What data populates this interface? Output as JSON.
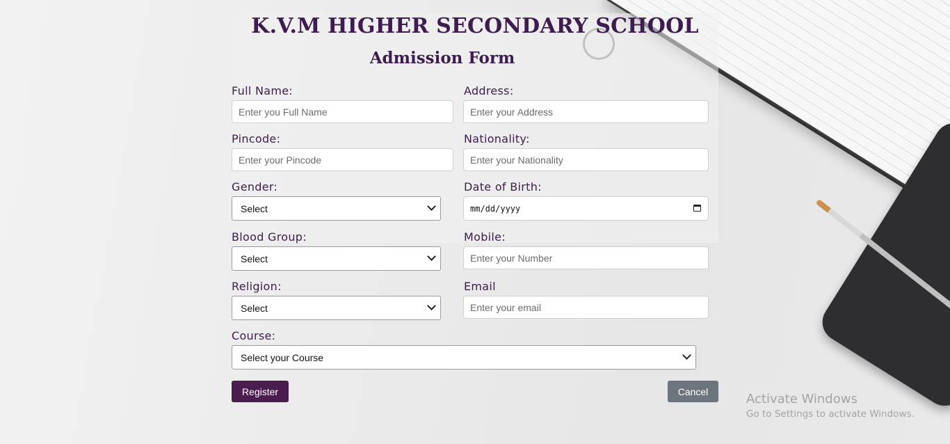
{
  "header": {
    "school_name": "K.V.M HIGHER SECONDARY SCHOOL",
    "form_title": "Admission Form"
  },
  "fields": {
    "full_name": {
      "label": "Full Name:",
      "placeholder": "Enter you Full Name"
    },
    "address": {
      "label": "Address:",
      "placeholder": "Enter your Address"
    },
    "pincode": {
      "label": "Pincode:",
      "placeholder": "Enter your Pincode"
    },
    "nationality": {
      "label": "Nationality:",
      "placeholder": "Enter your Nationality"
    },
    "gender": {
      "label": "Gender:",
      "selected": "Select"
    },
    "dob": {
      "label": "Date of Birth:",
      "value": "mm/dd/yyyy"
    },
    "blood_group": {
      "label": "Blood Group:",
      "selected": "Select"
    },
    "mobile": {
      "label": "Mobile:",
      "placeholder": "Enter your Number"
    },
    "religion": {
      "label": "Religion:",
      "selected": "Select"
    },
    "email": {
      "label": "Email",
      "placeholder": "Enter your email"
    },
    "course": {
      "label": "Course:",
      "selected": "Select your Course"
    }
  },
  "buttons": {
    "register": "Register",
    "cancel": "Cancel"
  },
  "watermark": {
    "title": "Activate Windows",
    "subtitle": "Go to Settings to activate Windows."
  },
  "colors": {
    "accent": "#3e1c4f",
    "register_button": "#4b1d4f",
    "cancel_button": "#6c757d"
  }
}
